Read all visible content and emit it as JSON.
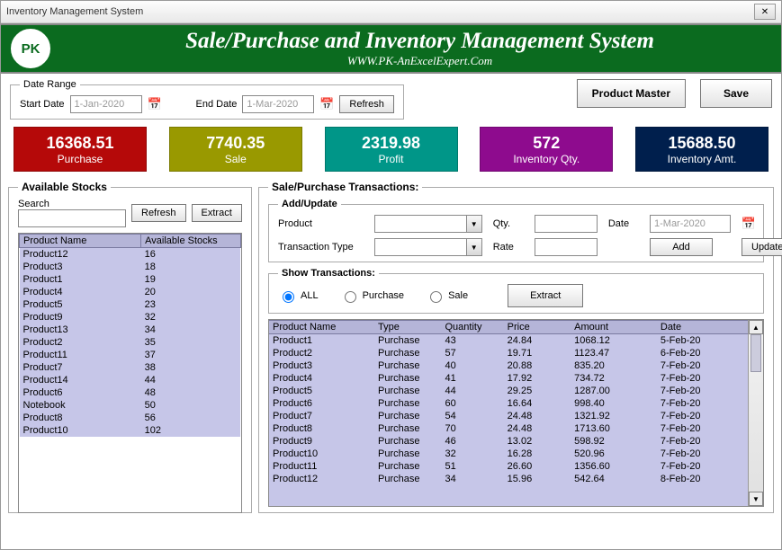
{
  "window_title": "Inventory Management System",
  "banner": {
    "title": "Sale/Purchase and Inventory Management System",
    "subtitle": "WWW.PK-AnExcelExpert.Com",
    "logo_text": "PK"
  },
  "date_range": {
    "legend": "Date Range",
    "start_label": "Start Date",
    "start_placeholder": "1-Jan-2020",
    "end_label": "End Date",
    "end_placeholder": "1-Mar-2020",
    "refresh": "Refresh"
  },
  "top_buttons": {
    "product_master": "Product Master",
    "save": "Save"
  },
  "cards": {
    "purchase": {
      "value": "16368.51",
      "label": "Purchase"
    },
    "sale": {
      "value": "7740.35",
      "label": "Sale"
    },
    "profit": {
      "value": "2319.98",
      "label": "Profit"
    },
    "qty": {
      "value": "572",
      "label": "Inventory Qty."
    },
    "amt": {
      "value": "15688.50",
      "label": "Inventory Amt."
    }
  },
  "available": {
    "legend": "Available Stocks",
    "search_label": "Search",
    "refresh": "Refresh",
    "extract": "Extract",
    "cols": {
      "name": "Product Name",
      "stocks": "Available Stocks"
    },
    "rows": [
      {
        "n": "Product12",
        "s": "16"
      },
      {
        "n": "Product3",
        "s": "18"
      },
      {
        "n": "Product1",
        "s": "19"
      },
      {
        "n": "Product4",
        "s": "20"
      },
      {
        "n": "Product5",
        "s": "23"
      },
      {
        "n": "Product9",
        "s": "32"
      },
      {
        "n": "Product13",
        "s": "34"
      },
      {
        "n": "Product2",
        "s": "35"
      },
      {
        "n": "Product11",
        "s": "37"
      },
      {
        "n": "Product7",
        "s": "38"
      },
      {
        "n": "Product14",
        "s": "44"
      },
      {
        "n": "Product6",
        "s": "48"
      },
      {
        "n": "Notebook",
        "s": "50"
      },
      {
        "n": "Product8",
        "s": "56"
      },
      {
        "n": "Product10",
        "s": "102"
      }
    ]
  },
  "trans": {
    "legend": "Sale/Purchase Transactions:",
    "addupd": {
      "legend": "Add/Update",
      "product": "Product",
      "qty": "Qty.",
      "date": "Date",
      "date_placeholder": "1-Mar-2020",
      "ttype": "Transaction Type",
      "rate": "Rate",
      "add": "Add",
      "update": "Update"
    },
    "show": {
      "legend": "Show Transactions:",
      "all": "ALL",
      "purchase": "Purchase",
      "sale": "Sale",
      "extract": "Extract"
    },
    "cols": {
      "name": "Product Name",
      "type": "Type",
      "qty": "Quantity",
      "price": "Price",
      "amount": "Amount",
      "date": "Date"
    },
    "rows": [
      {
        "n": "Product1",
        "t": "Purchase",
        "q": "43",
        "p": "24.84",
        "a": "1068.12",
        "d": "5-Feb-20"
      },
      {
        "n": "Product2",
        "t": "Purchase",
        "q": "57",
        "p": "19.71",
        "a": "1123.47",
        "d": "6-Feb-20"
      },
      {
        "n": "Product3",
        "t": "Purchase",
        "q": "40",
        "p": "20.88",
        "a": "835.20",
        "d": "7-Feb-20"
      },
      {
        "n": "Product4",
        "t": "Purchase",
        "q": "41",
        "p": "17.92",
        "a": "734.72",
        "d": "7-Feb-20"
      },
      {
        "n": "Product5",
        "t": "Purchase",
        "q": "44",
        "p": "29.25",
        "a": "1287.00",
        "d": "7-Feb-20"
      },
      {
        "n": "Product6",
        "t": "Purchase",
        "q": "60",
        "p": "16.64",
        "a": "998.40",
        "d": "7-Feb-20"
      },
      {
        "n": "Product7",
        "t": "Purchase",
        "q": "54",
        "p": "24.48",
        "a": "1321.92",
        "d": "7-Feb-20"
      },
      {
        "n": "Product8",
        "t": "Purchase",
        "q": "70",
        "p": "24.48",
        "a": "1713.60",
        "d": "7-Feb-20"
      },
      {
        "n": "Product9",
        "t": "Purchase",
        "q": "46",
        "p": "13.02",
        "a": "598.92",
        "d": "7-Feb-20"
      },
      {
        "n": "Product10",
        "t": "Purchase",
        "q": "32",
        "p": "16.28",
        "a": "520.96",
        "d": "7-Feb-20"
      },
      {
        "n": "Product11",
        "t": "Purchase",
        "q": "51",
        "p": "26.60",
        "a": "1356.60",
        "d": "7-Feb-20"
      },
      {
        "n": "Product12",
        "t": "Purchase",
        "q": "34",
        "p": "15.96",
        "a": "542.64",
        "d": "8-Feb-20"
      }
    ]
  }
}
